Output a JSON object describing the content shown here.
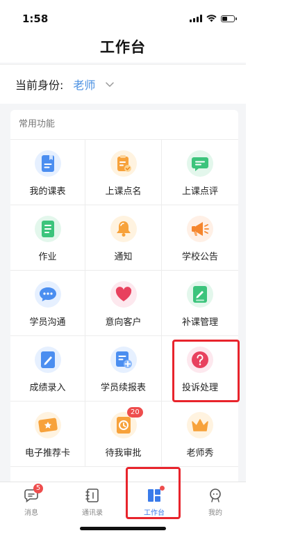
{
  "status": {
    "time": "1:58"
  },
  "header": {
    "title": "工作台"
  },
  "identity": {
    "label": "当前身份:",
    "value": "老师"
  },
  "section": {
    "title": "常用功能"
  },
  "functions": [
    {
      "label": "我的课表",
      "icon": "schedule-icon"
    },
    {
      "label": "上课点名",
      "icon": "roll-call-icon"
    },
    {
      "label": "上课点评",
      "icon": "comment-icon"
    },
    {
      "label": "作业",
      "icon": "homework-icon"
    },
    {
      "label": "通知",
      "icon": "bell-icon"
    },
    {
      "label": "学校公告",
      "icon": "megaphone-icon"
    },
    {
      "label": "学员沟通",
      "icon": "chat-icon"
    },
    {
      "label": "意向客户",
      "icon": "heart-icon"
    },
    {
      "label": "补课管理",
      "icon": "makeup-class-icon"
    },
    {
      "label": "成绩录入",
      "icon": "pen-icon"
    },
    {
      "label": "学员续报表",
      "icon": "renewal-report-icon"
    },
    {
      "label": "投诉处理",
      "icon": "question-icon"
    },
    {
      "label": "电子推荐卡",
      "icon": "star-card-icon"
    },
    {
      "label": "待我审批",
      "icon": "approval-icon",
      "badge": "20"
    },
    {
      "label": "老师秀",
      "icon": "crown-icon"
    }
  ],
  "tabbar": {
    "items": [
      {
        "label": "消息",
        "icon": "message-icon",
        "badge": "5"
      },
      {
        "label": "通讯录",
        "icon": "contacts-icon"
      },
      {
        "label": "工作台",
        "icon": "workbench-icon",
        "active": true
      },
      {
        "label": "我的",
        "icon": "profile-icon"
      }
    ]
  },
  "colors": {
    "accent": "#3a7bea",
    "badge": "#ee4d4d",
    "highlight": "#e8242c"
  }
}
